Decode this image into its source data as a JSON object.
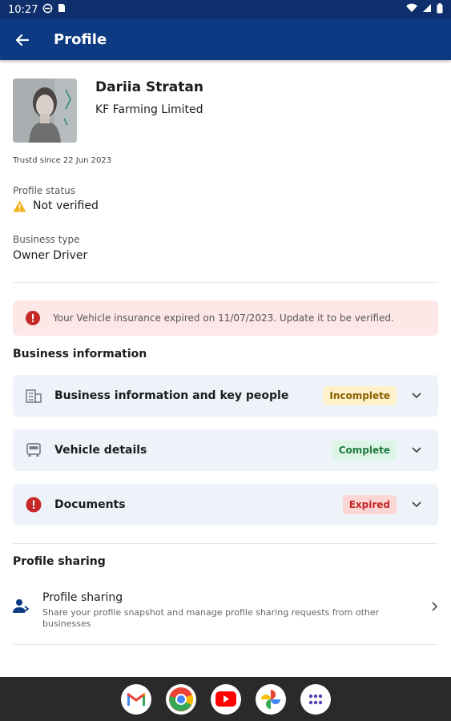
{
  "status_bar": {
    "time": "10:27"
  },
  "app_bar": {
    "title": "Profile"
  },
  "profile": {
    "name": "Dariia Stratan",
    "company": "KF Farming Limited",
    "trusted_since": "Trustd since 22 Jun 2023",
    "status_label": "Profile status",
    "status_value": "Not verified",
    "business_type_label": "Business type",
    "business_type_value": "Owner Driver"
  },
  "alert": {
    "text": "Your Vehicle insurance expired on 11/07/2023. Update it to be verified."
  },
  "business_information": {
    "title": "Business information",
    "cards": [
      {
        "label": "Business information and key people",
        "badge": "Incomplete",
        "icon": "building-icon"
      },
      {
        "label": "Vehicle details",
        "badge": "Complete",
        "icon": "truck-icon"
      },
      {
        "label": "Documents",
        "badge": "Expired",
        "icon": "error-icon"
      }
    ]
  },
  "profile_sharing": {
    "section_title": "Profile sharing",
    "item_title": "Profile sharing",
    "item_description": "Share your profile snapshot and manage profile sharing requests from other businesses"
  },
  "colors": {
    "app_bar": "#0e3a83",
    "incomplete_bg": "#fff1cc",
    "incomplete_fg": "#8a6100",
    "complete_bg": "#dcf5e5",
    "complete_fg": "#1f7a43",
    "expired_bg": "#fdd6d6",
    "expired_fg": "#c62828"
  },
  "dock": [
    "gmail-icon",
    "chrome-icon",
    "youtube-icon",
    "photos-icon",
    "apps-icon"
  ]
}
